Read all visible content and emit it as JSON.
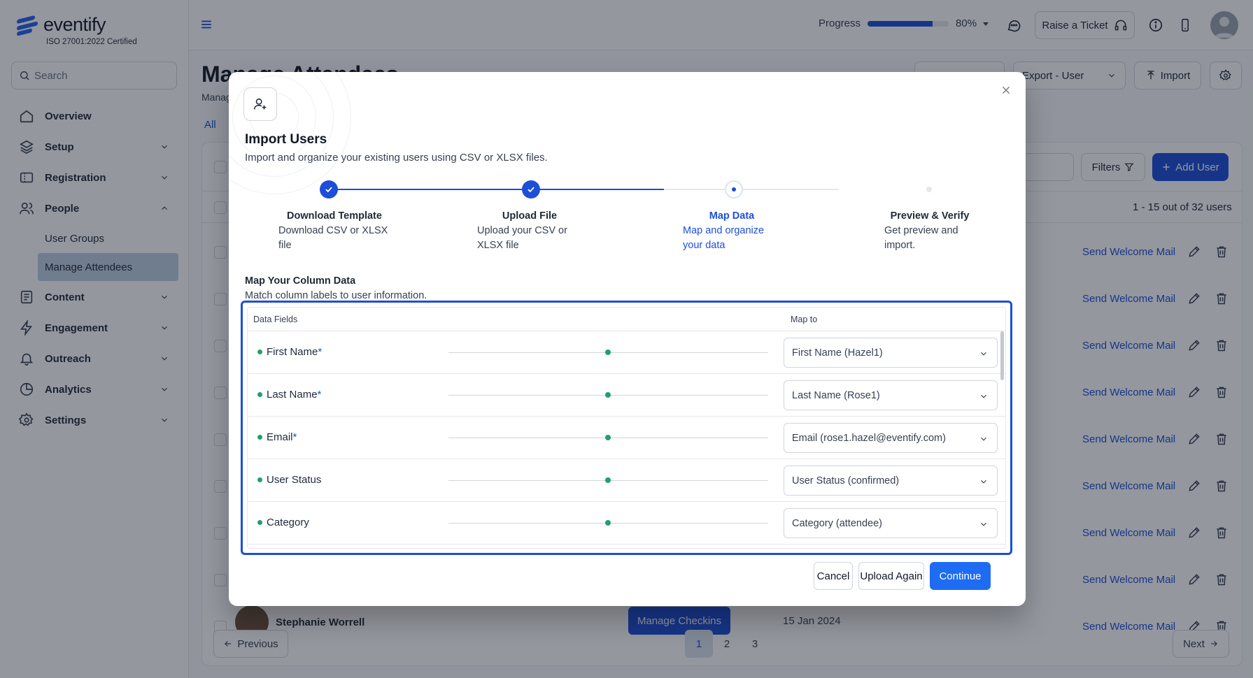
{
  "brand": {
    "name": "eventify",
    "certification": "ISO 27001:2022 Certified"
  },
  "sidebar": {
    "search_placeholder": "Search",
    "items": [
      {
        "label": "Overview",
        "icon": "home-icon",
        "expandable": false
      },
      {
        "label": "Setup",
        "icon": "layers-icon",
        "expandable": true
      },
      {
        "label": "Registration",
        "icon": "ticket-icon",
        "expandable": true
      },
      {
        "label": "People",
        "icon": "users-icon",
        "expandable": true,
        "expanded": true
      },
      {
        "label": "Content",
        "icon": "document-icon",
        "expandable": true
      },
      {
        "label": "Engagement",
        "icon": "lightning-icon",
        "expandable": true
      },
      {
        "label": "Outreach",
        "icon": "bell-icon",
        "expandable": true
      },
      {
        "label": "Analytics",
        "icon": "pie-chart-icon",
        "expandable": true
      },
      {
        "label": "Settings",
        "icon": "gear-icon",
        "expandable": true
      }
    ],
    "people_subitems": [
      "User Groups",
      "Manage Attendees"
    ],
    "active_subitem": "Manage Attendees"
  },
  "topbar": {
    "progress_label": "Progress",
    "progress_value": 0.8,
    "progress_text": "80%",
    "raise_ticket": "Raise a Ticket"
  },
  "page": {
    "title": "Manage Attendees",
    "subtitle": "Manag",
    "tab_all": "All",
    "export_label": "Export - User",
    "import_label": "Import",
    "filters_label": "Filters",
    "add_user_label": "Add User",
    "count_text": "1 - 15 out of 32 users",
    "row_action": "Send Welcome Mail",
    "last_row": {
      "name": "Stephanie Worrell",
      "checkins_label": "Manage Checkins",
      "date": "15 Jan 2024"
    },
    "pagination": {
      "previous": "Previous",
      "next": "Next",
      "pages": [
        "1",
        "2",
        "3"
      ],
      "current": "1"
    }
  },
  "modal": {
    "title": "Import Users",
    "subtitle": "Import and organize your existing users using CSV or XLSX files.",
    "steps": [
      {
        "title": "Download Template",
        "desc": "Download CSV or XLSX file",
        "status": "done"
      },
      {
        "title": "Upload File",
        "desc": "Upload your CSV or XLSX file",
        "status": "done"
      },
      {
        "title": "Map Data",
        "desc": "Map and organize your data",
        "status": "current"
      },
      {
        "title": "Preview & Verify",
        "desc": "Get preview and import.",
        "status": "todo"
      }
    ],
    "map_title": "Map Your Column Data",
    "map_subtitle": "Match column labels to user information.",
    "columns": {
      "fields": "Data Fields",
      "map_to": "Map to"
    },
    "rows": [
      {
        "field": "First Name",
        "required": "*",
        "mapped": "First Name (Hazel1)"
      },
      {
        "field": "Last Name",
        "required": "*",
        "mapped": "Last Name (Rose1)"
      },
      {
        "field": "Email",
        "required": "*",
        "mapped": "Email (rose1.hazel@eventify.com)"
      },
      {
        "field": "User Status",
        "required": "",
        "mapped": "User Status (confirmed)"
      },
      {
        "field": "Category",
        "required": "",
        "mapped": "Category (attendee)"
      }
    ],
    "buttons": {
      "cancel": "Cancel",
      "upload_again": "Upload Again",
      "continue": "Continue"
    }
  },
  "colors": {
    "primary": "#1d4ed8",
    "continue": "#1d6cf2",
    "mapped_dot": "#22a06b",
    "active_nav_bg": "#bcd0e2"
  }
}
